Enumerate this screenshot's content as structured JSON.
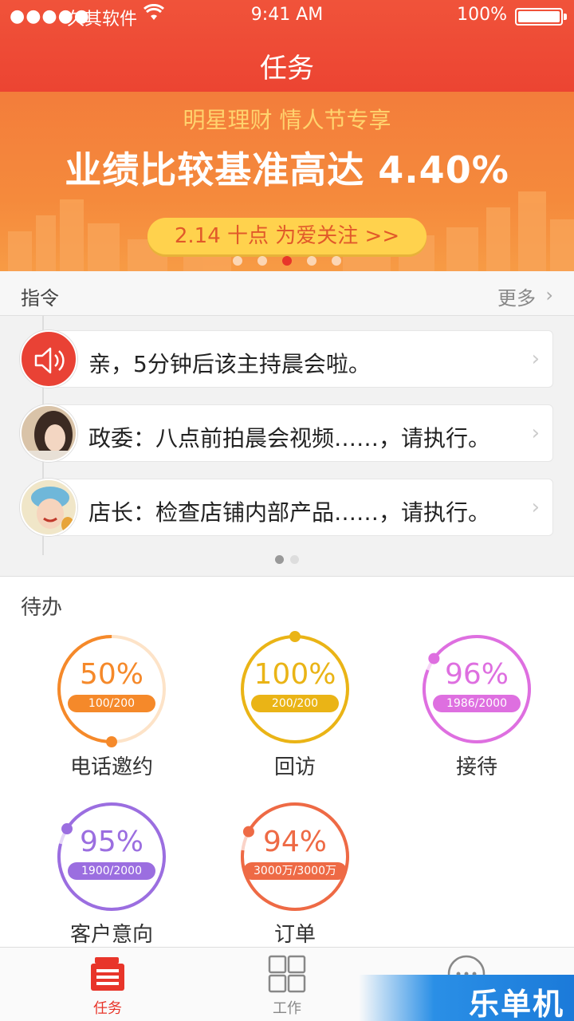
{
  "status_bar": {
    "signal": "●●●●●",
    "carrier": "久其软件",
    "time": "9:41 AM",
    "battery": "100%"
  },
  "nav": {
    "title": "任务"
  },
  "banner": {
    "subtitle": "明星理财   情人节专享",
    "headline": "业绩比较基准高达 4.40%",
    "button": "2.14 十点 为爱关注 >>",
    "active_dot": 2,
    "dot_count": 5
  },
  "orders": {
    "title": "指令",
    "more": "更多",
    "items": [
      {
        "icon": "speaker-icon",
        "text": "亲，5分钟后该主持晨会啦。"
      },
      {
        "icon": "avatar",
        "text": "政委：八点前拍晨会视频……，请执行。"
      },
      {
        "icon": "avatar",
        "text": "店长：检查店铺内部产品……，请执行。"
      }
    ]
  },
  "todo": {
    "title": "待办",
    "items": [
      {
        "percent": "50%",
        "ratio": "100/200",
        "label": "电话邀约",
        "color": "#f5892a",
        "track": "#fde3c8",
        "value": 0.5
      },
      {
        "percent": "100%",
        "ratio": "200/200",
        "label": "回访",
        "color": "#eab416",
        "track": "#fbeab2",
        "value": 1.0
      },
      {
        "percent": "96%",
        "ratio": "1986/2000",
        "label": "接待",
        "color": "#de6fe0",
        "track": "#f7d6f7",
        "value": 0.96
      },
      {
        "percent": "95%",
        "ratio": "1900/2000",
        "label": "客户意向",
        "color": "#9b6ee0",
        "track": "#e4d6f7",
        "value": 0.95
      },
      {
        "percent": "94%",
        "ratio": "3000万/3000万",
        "label": "订单",
        "color": "#ee6a45",
        "track": "#fad3c8",
        "value": 0.94
      }
    ]
  },
  "tabbar": {
    "tabs": [
      {
        "label": "任务",
        "active": true,
        "color": "#e8352a"
      },
      {
        "label": "工作",
        "active": false,
        "color": "#888888"
      },
      {
        "label": "更多",
        "active": false,
        "color": "#888888"
      }
    ]
  },
  "watermark": "乐单机"
}
